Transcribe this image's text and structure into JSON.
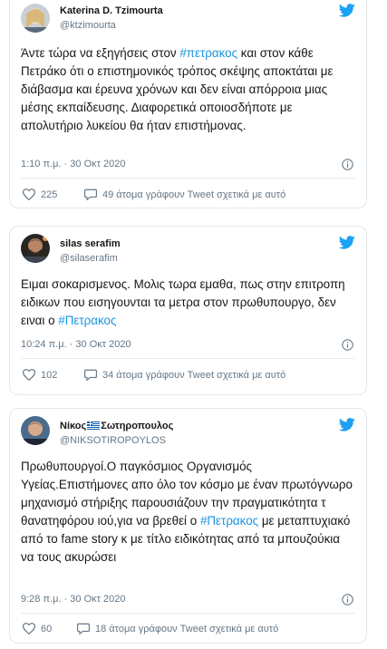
{
  "tweets": [
    {
      "name": "Katerina D. Tzimourta",
      "handle": "@ktzimourta",
      "text_before": "Άντε τώρα να εξηγήσεις στον ",
      "hashtag": "#πετρακος",
      "text_after": " και στον κάθε Πετράκο ότι ο επιστημονικός τρόπος σκέψης αποκτάται με διάβασμα και έρευνα χρόνων και δεν είναι απόρροια μιας μέσης εκπαίδευσης. Διαφορετικά οποιοσδήποτε με απολυτήριο λυκείου θα ήταν επιστήμονας.",
      "timestamp": "1:10 π.μ. · 30 Οκτ 2020",
      "likes": "225",
      "talking": "49 άτομα γράφουν Tweet σχετικά με αυτό"
    },
    {
      "name": "silas serafim",
      "handle": "@silaserafim",
      "text_before": "Ειμαι σοκαρισμενος. Μολις τωρα εμαθα, πως στην επιτροπη ειδικων που εισηγουνται τα μετρα στον πρωθυπουργο, δεν ειναι ο ",
      "hashtag": "#Πετρακος",
      "text_after": "",
      "timestamp": "10:24 π.μ. · 30 Οκτ 2020",
      "likes": "102",
      "talking": "34 άτομα γράφουν Tweet σχετικά με αυτό"
    },
    {
      "name_first": "Νίκος",
      "name_last": "Σωτηροπουλος",
      "handle": "@NIKSOTIROPOYLOS",
      "text_before": "Πρωθυπουργοί.Ο παγκόσμιος Οργανισμός Υγείας.Επιστήμονες απο όλο τον κόσμο με έναν πρωτόγνωρο μηχανισμό στήριξης παρουσιάζουν την πραγματικότητα τ θανατηφόρου ιού,για να βρεθεί ο ",
      "hashtag": "#Πετρακος",
      "text_after": " με μεταπτυχιακό από το fame story κ με τίτλο ειδικότητας από τα μπουζούκια να τους ακυρώσει",
      "timestamp": "9:28 π.μ. · 30 Οκτ 2020",
      "likes": "60",
      "talking": "18 άτομα γράφουν Tweet σχετικά με αυτό"
    }
  ],
  "icons": {
    "brand": "twitter-bird-icon",
    "like": "heart-icon",
    "reply": "speech-bubble-icon",
    "info": "info-icon"
  },
  "colors": {
    "accent": "#1da1f2",
    "hashtag": "#1b95e0",
    "muted": "#657786",
    "border": "#e1e8ed"
  }
}
